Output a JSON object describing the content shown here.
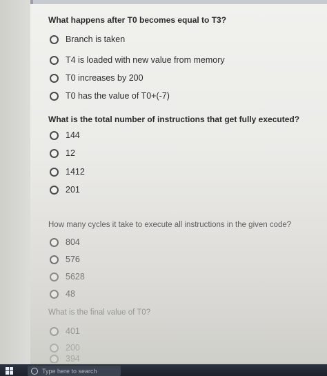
{
  "questions": [
    {
      "text": "What happens after T0 becomes equal to T3?",
      "options": [
        "Branch is taken",
        "T4 is loaded with new value from memory",
        "T0 increases by 200",
        "T0 has the value of T0+(-7)"
      ]
    },
    {
      "text": "What is the total number of instructions that get fully executed?",
      "options": [
        "144",
        "12",
        "1412",
        "201"
      ]
    },
    {
      "text": "How many cycles it take to execute all instructions in the given code?",
      "options": [
        "804",
        "576",
        "5628",
        "48"
      ]
    },
    {
      "text": "What is the final value of T0?",
      "options": [
        "401",
        "200",
        "394"
      ]
    }
  ],
  "taskbar": {
    "search_placeholder": "Type here to search"
  },
  "icons": {
    "start": "windows-start-icon",
    "search": "search-icon",
    "radio": "radio-button-empty"
  }
}
